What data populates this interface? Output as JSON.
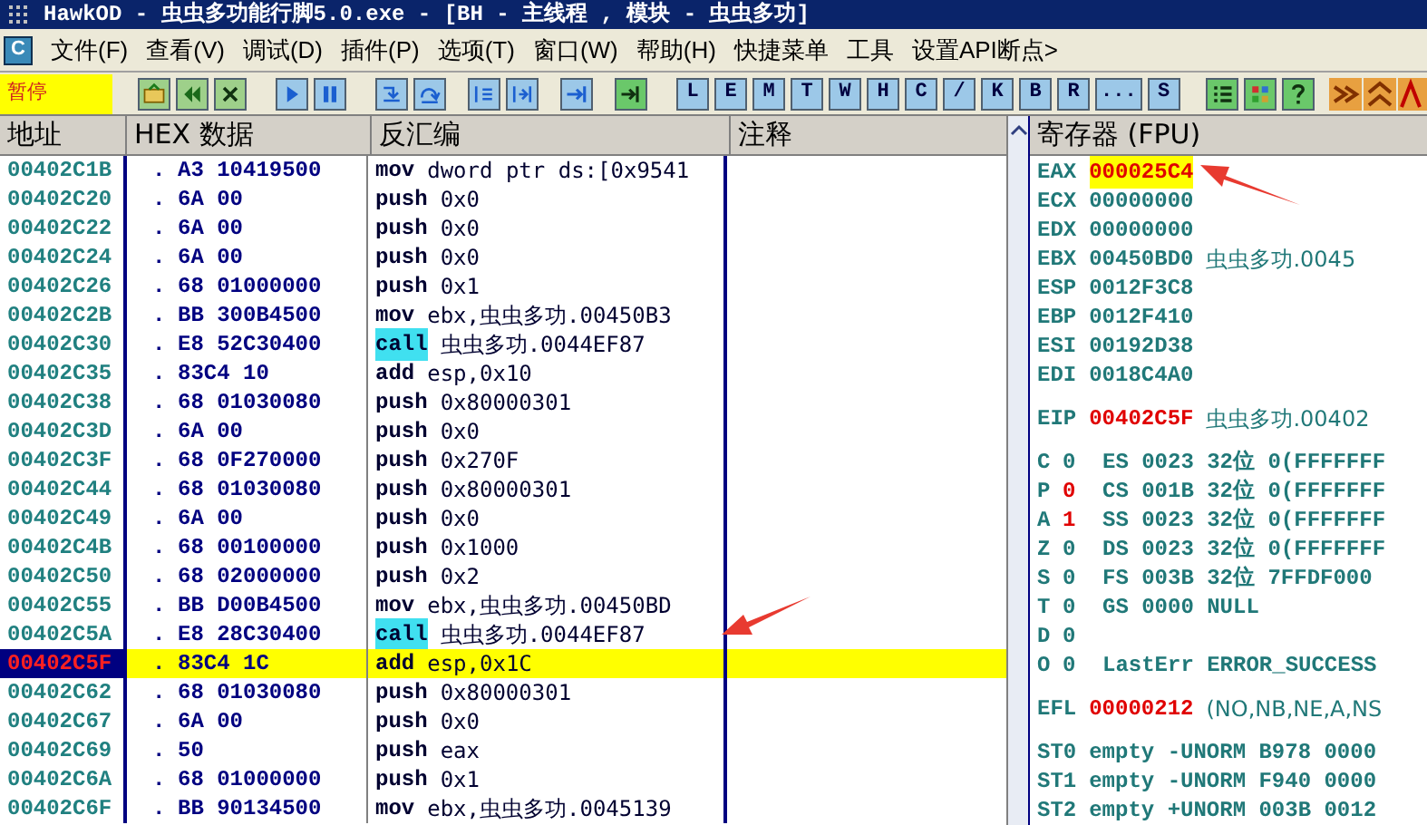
{
  "window": {
    "title": "HawkOD  - 虫虫多功能行脚5.0.exe - [BH - 主线程 , 模块 - 虫虫多功]"
  },
  "menu": {
    "logo": "C",
    "items": [
      "文件(F)",
      "查看(V)",
      "调试(D)",
      "插件(P)",
      "选项(T)",
      "窗口(W)",
      "帮助(H)",
      "快捷菜单",
      "工具",
      "设置API断点>"
    ]
  },
  "toolbar": {
    "status": "暂停",
    "letter_buttons": [
      "L",
      "E",
      "M",
      "T",
      "W",
      "H",
      "C",
      "/",
      "K",
      "B",
      "R",
      "...",
      "S"
    ]
  },
  "disassembly": {
    "columns": [
      "地址",
      "HEX 数据",
      "反汇编",
      "注释"
    ],
    "rows": [
      {
        "address": "00402C1B",
        "marker": ".",
        "hex": "A3 10419500",
        "mnemonic": "mov",
        "operands": "dword ptr ds:[0x9541",
        "highlight": false,
        "selected": false
      },
      {
        "address": "00402C20",
        "marker": ".",
        "hex": "6A 00",
        "mnemonic": "push",
        "operands": "0x0",
        "highlight": false,
        "selected": false
      },
      {
        "address": "00402C22",
        "marker": ".",
        "hex": "6A 00",
        "mnemonic": "push",
        "operands": "0x0",
        "highlight": false,
        "selected": false
      },
      {
        "address": "00402C24",
        "marker": ".",
        "hex": "6A 00",
        "mnemonic": "push",
        "operands": "0x0",
        "highlight": false,
        "selected": false
      },
      {
        "address": "00402C26",
        "marker": ".",
        "hex": "68 01000000",
        "mnemonic": "push",
        "operands": "0x1",
        "highlight": false,
        "selected": false
      },
      {
        "address": "00402C2B",
        "marker": ".",
        "hex": "BB 300B4500",
        "mnemonic": "mov",
        "operands": "ebx,虫虫多功.00450B3",
        "highlight": false,
        "selected": false
      },
      {
        "address": "00402C30",
        "marker": ".",
        "hex": "E8 52C30400",
        "mnemonic": "call",
        "operands": "虫虫多功.0044EF87",
        "highlight": true,
        "selected": false
      },
      {
        "address": "00402C35",
        "marker": ".",
        "hex": "83C4 10",
        "mnemonic": "add",
        "operands": "esp,0x10",
        "highlight": false,
        "selected": false
      },
      {
        "address": "00402C38",
        "marker": ".",
        "hex": "68 01030080",
        "mnemonic": "push",
        "operands": "0x80000301",
        "highlight": false,
        "selected": false
      },
      {
        "address": "00402C3D",
        "marker": ".",
        "hex": "6A 00",
        "mnemonic": "push",
        "operands": "0x0",
        "highlight": false,
        "selected": false
      },
      {
        "address": "00402C3F",
        "marker": ".",
        "hex": "68 0F270000",
        "mnemonic": "push",
        "operands": "0x270F",
        "highlight": false,
        "selected": false
      },
      {
        "address": "00402C44",
        "marker": ".",
        "hex": "68 01030080",
        "mnemonic": "push",
        "operands": "0x80000301",
        "highlight": false,
        "selected": false
      },
      {
        "address": "00402C49",
        "marker": ".",
        "hex": "6A 00",
        "mnemonic": "push",
        "operands": "0x0",
        "highlight": false,
        "selected": false
      },
      {
        "address": "00402C4B",
        "marker": ".",
        "hex": "68 00100000",
        "mnemonic": "push",
        "operands": "0x1000",
        "highlight": false,
        "selected": false
      },
      {
        "address": "00402C50",
        "marker": ".",
        "hex": "68 02000000",
        "mnemonic": "push",
        "operands": "0x2",
        "highlight": false,
        "selected": false
      },
      {
        "address": "00402C55",
        "marker": ".",
        "hex": "BB D00B4500",
        "mnemonic": "mov",
        "operands": "ebx,虫虫多功.00450BD",
        "highlight": false,
        "selected": false
      },
      {
        "address": "00402C5A",
        "marker": ".",
        "hex": "E8 28C30400",
        "mnemonic": "call",
        "operands": "虫虫多功.0044EF87",
        "highlight": true,
        "selected": false
      },
      {
        "address": "00402C5F",
        "marker": ".",
        "hex": "83C4 1C",
        "mnemonic": "add",
        "operands": "esp,0x1C",
        "highlight": false,
        "selected": true
      },
      {
        "address": "00402C62",
        "marker": ".",
        "hex": "68 01030080",
        "mnemonic": "push",
        "operands": "0x80000301",
        "highlight": false,
        "selected": false
      },
      {
        "address": "00402C67",
        "marker": ".",
        "hex": "6A 00",
        "mnemonic": "push",
        "operands": "0x0",
        "highlight": false,
        "selected": false
      },
      {
        "address": "00402C69",
        "marker": ".",
        "hex": "50",
        "mnemonic": "push",
        "operands": "eax",
        "highlight": false,
        "selected": false
      },
      {
        "address": "00402C6A",
        "marker": ".",
        "hex": "68 01000000",
        "mnemonic": "push",
        "operands": "0x1",
        "highlight": false,
        "selected": false
      },
      {
        "address": "00402C6F",
        "marker": ".",
        "hex": "BB 90134500",
        "mnemonic": "mov",
        "operands": "ebx,虫虫多功.0045139",
        "highlight": false,
        "selected": false
      }
    ]
  },
  "registers": {
    "title": "寄存器 (FPU)",
    "general": [
      {
        "name": "EAX",
        "value": "000025C4",
        "changed": true,
        "selected": true
      },
      {
        "name": "ECX",
        "value": "00000000",
        "changed": false,
        "selected": false
      },
      {
        "name": "EDX",
        "value": "00000000",
        "changed": false,
        "selected": false
      },
      {
        "name": "EBX",
        "value": "00450BD0",
        "changed": false,
        "selected": false,
        "comment": "虫虫多功.0045"
      },
      {
        "name": "ESP",
        "value": "0012F3C8",
        "changed": false,
        "selected": false
      },
      {
        "name": "EBP",
        "value": "0012F410",
        "changed": false,
        "selected": false
      },
      {
        "name": "ESI",
        "value": "00192D38",
        "changed": false,
        "selected": false
      },
      {
        "name": "EDI",
        "value": "0018C4A0",
        "changed": false,
        "selected": false
      }
    ],
    "eip": {
      "name": "EIP",
      "value": "00402C5F",
      "changed": true,
      "selected": false,
      "comment": "虫虫多功.00402"
    },
    "flags": [
      {
        "name": "C",
        "value": "0",
        "changed": false,
        "segment": "ES 0023 32位 0(FFFFFFF"
      },
      {
        "name": "P",
        "value": "0",
        "changed": true,
        "segment": "CS 001B 32位 0(FFFFFFF"
      },
      {
        "name": "A",
        "value": "1",
        "changed": true,
        "segment": "SS 0023 32位 0(FFFFFFF"
      },
      {
        "name": "Z",
        "value": "0",
        "changed": false,
        "segment": "DS 0023 32位 0(FFFFFFF"
      },
      {
        "name": "S",
        "value": "0",
        "changed": false,
        "segment": "FS 003B 32位 7FFDF000"
      },
      {
        "name": "T",
        "value": "0",
        "changed": false,
        "segment": "GS 0000 NULL"
      },
      {
        "name": "D",
        "value": "0",
        "changed": false
      },
      {
        "name": "O",
        "value": "0",
        "changed": false,
        "segment": "LastErr ERROR_SUCCESS"
      }
    ],
    "efl": {
      "name": "EFL",
      "value": "00000212",
      "changed": true,
      "selected": false,
      "comment": "(NO,NB,NE,A,NS"
    },
    "fpu": [
      {
        "name": "ST0",
        "value": "empty -UNORM B978 0000"
      },
      {
        "name": "ST1",
        "value": "empty -UNORM F940 0000"
      },
      {
        "name": "ST2",
        "value": "empty +UNORM 003B 0012"
      }
    ]
  }
}
